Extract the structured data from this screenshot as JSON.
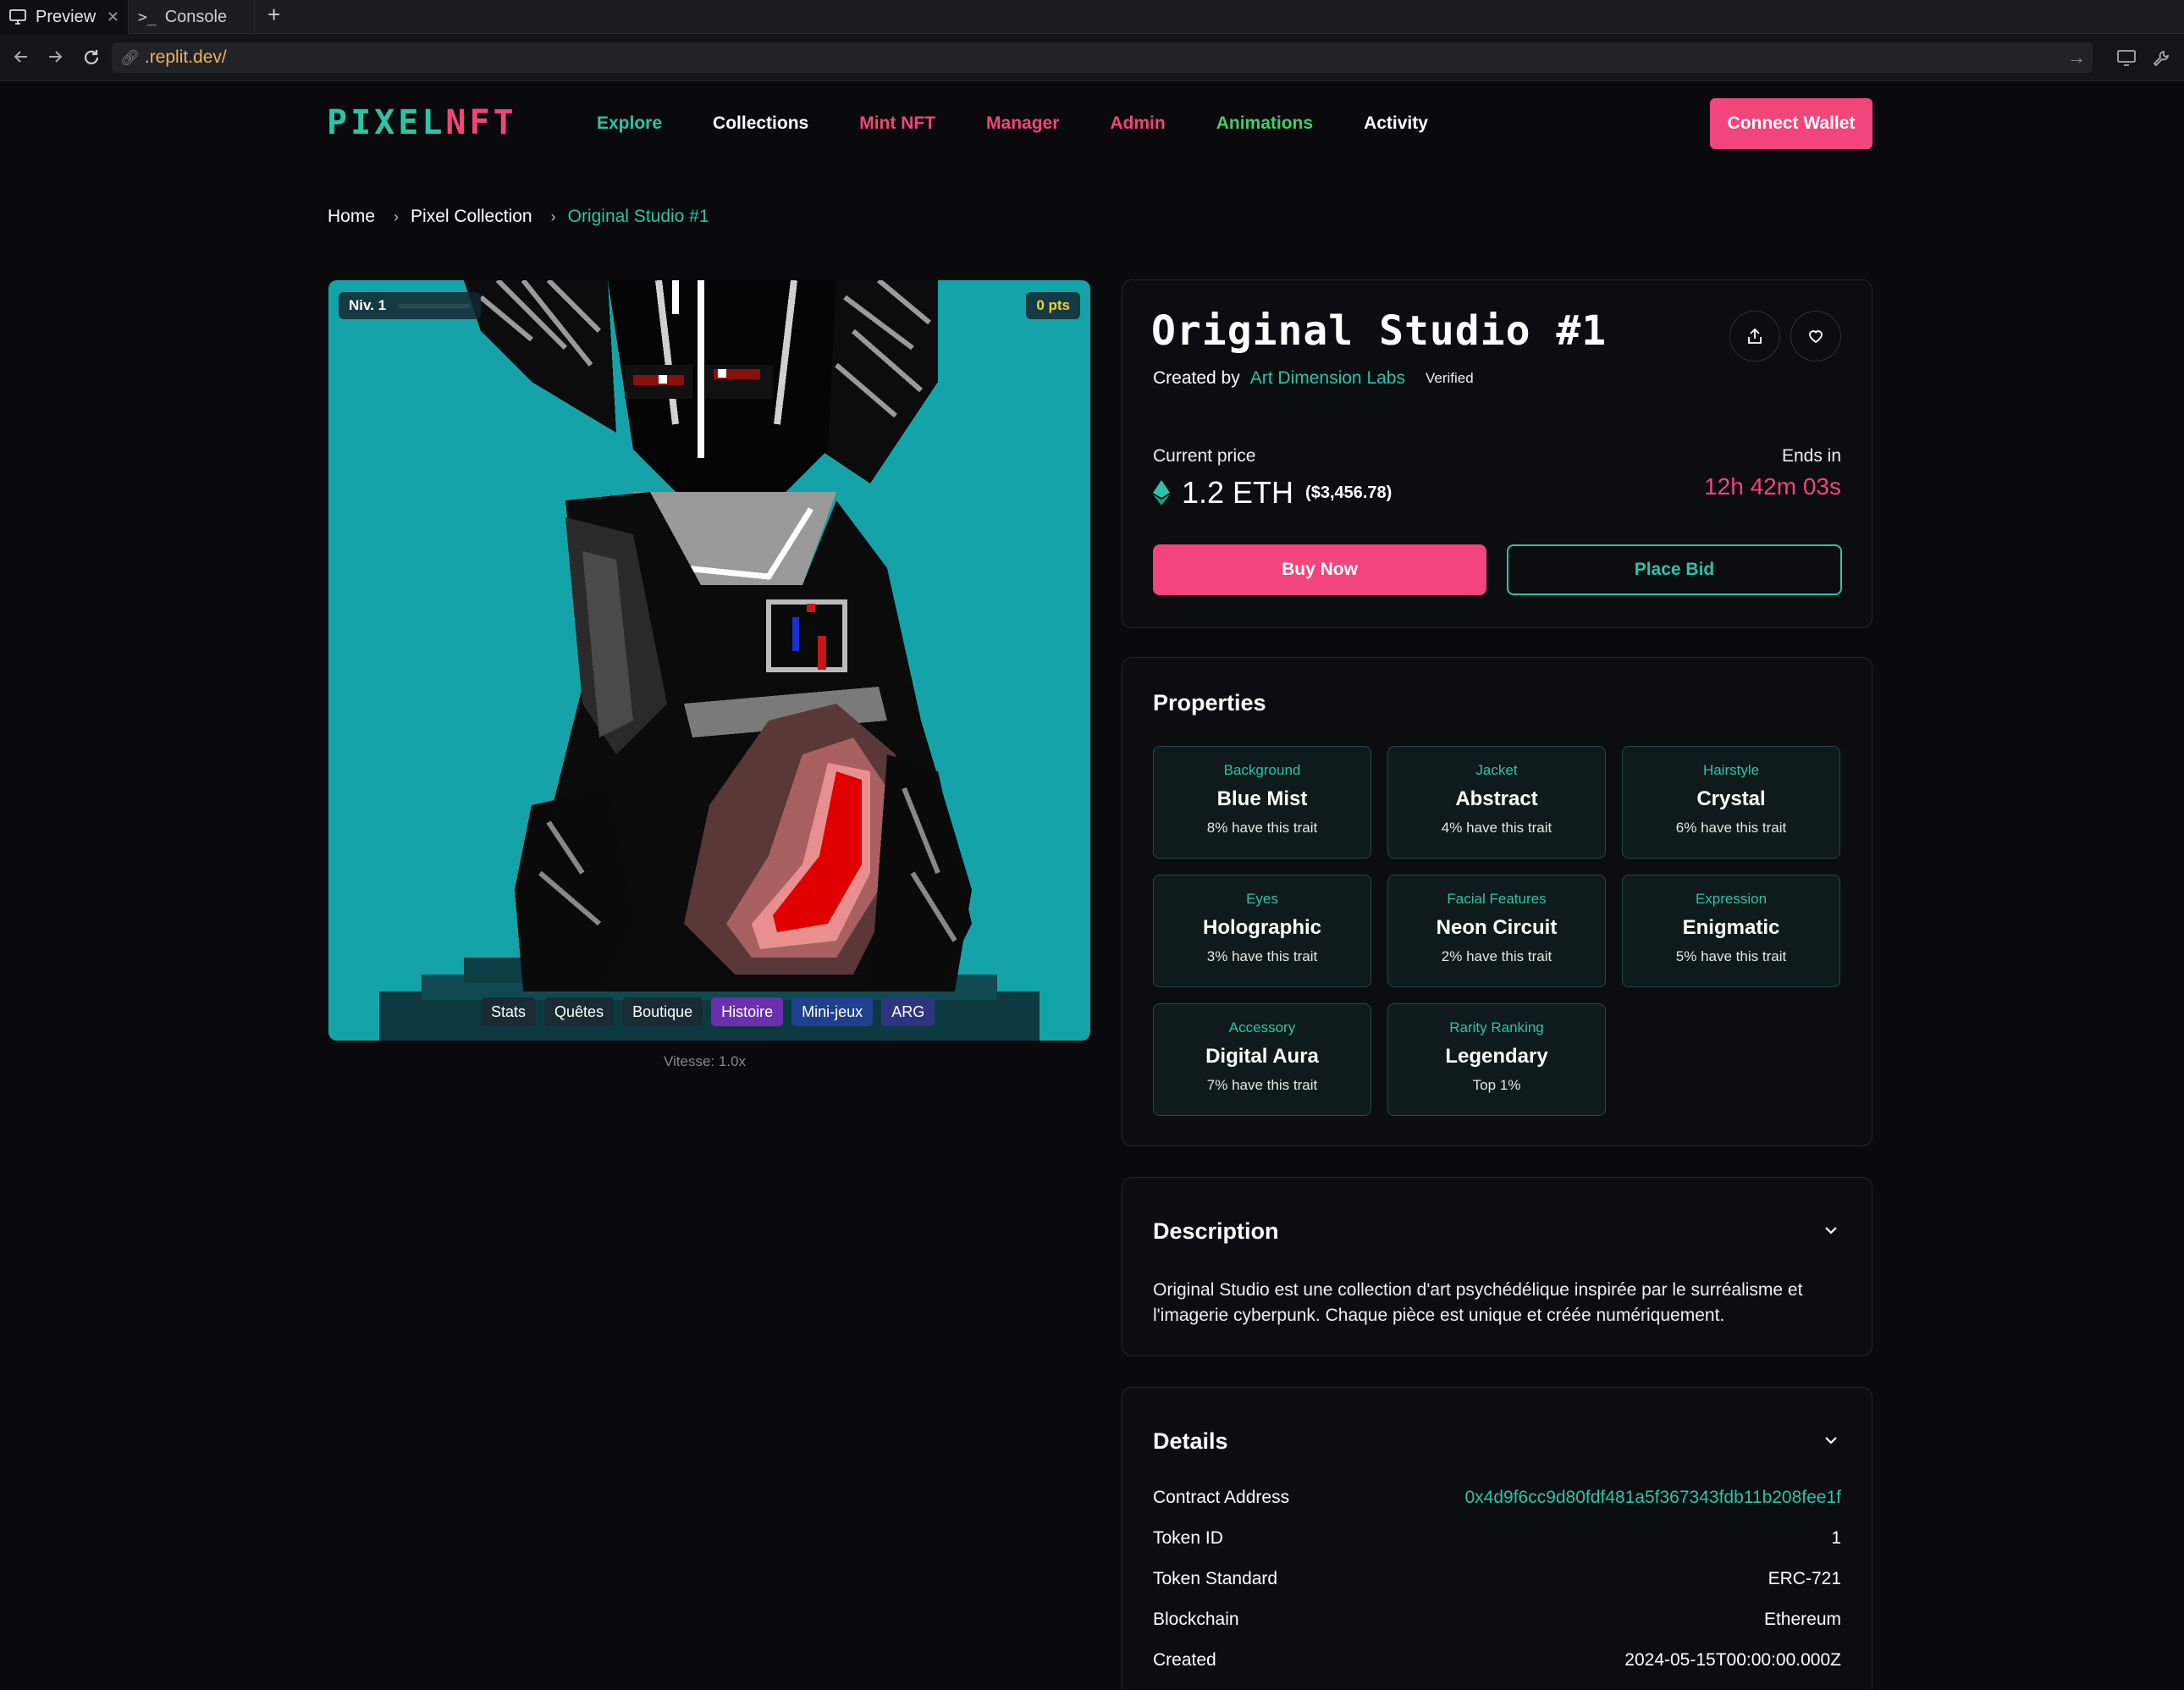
{
  "browser": {
    "tabs": [
      {
        "label": "Preview"
      },
      {
        "label": "Console"
      }
    ],
    "url": ".replit.dev/"
  },
  "header": {
    "logo_part1": "PIXEL",
    "logo_part2": "NFT",
    "menu": [
      {
        "label": "Explore",
        "color": "#2bc4a8"
      },
      {
        "label": "Collections",
        "color": "#ffffff"
      },
      {
        "label": "Mint NFT",
        "color": "#f2457b"
      },
      {
        "label": "Manager",
        "color": "#f2457b"
      },
      {
        "label": "Admin",
        "color": "#f2457b"
      },
      {
        "label": "Animations",
        "color": "#3fcf6a"
      },
      {
        "label": "Activity",
        "color": "#ffffff"
      }
    ],
    "connect_label": "Connect Wallet"
  },
  "breadcrumb": {
    "home": "Home",
    "collection": "Pixel Collection",
    "current": "Original Studio #1"
  },
  "artwork": {
    "level": "Niv. 1",
    "points": "0 pts",
    "tabs": [
      "Stats",
      "Quêtes",
      "Boutique",
      "Histoire",
      "Mini-jeux",
      "ARG"
    ],
    "speed": "Vitesse: 1.0x"
  },
  "nft": {
    "title": "Original Studio #1",
    "created_by_label": "Created by",
    "creator": "Art Dimension Labs",
    "verified": "Verified",
    "price_label": "Current price",
    "price_eth": "1.2 ETH",
    "price_usd": "($3,456.78)",
    "ends_label": "Ends in",
    "ends_value": "12h 42m 03s",
    "buy_label": "Buy Now",
    "bid_label": "Place Bid"
  },
  "properties": {
    "title": "Properties",
    "items": [
      {
        "key": "Background",
        "value": "Blue Mist",
        "rarity": "8% have this trait"
      },
      {
        "key": "Jacket",
        "value": "Abstract",
        "rarity": "4% have this trait"
      },
      {
        "key": "Hairstyle",
        "value": "Crystal",
        "rarity": "6% have this trait"
      },
      {
        "key": "Eyes",
        "value": "Holographic",
        "rarity": "3% have this trait"
      },
      {
        "key": "Facial Features",
        "value": "Neon Circuit",
        "rarity": "2% have this trait"
      },
      {
        "key": "Expression",
        "value": "Enigmatic",
        "rarity": "5% have this trait"
      },
      {
        "key": "Accessory",
        "value": "Digital Aura",
        "rarity": "7% have this trait"
      },
      {
        "key": "Rarity Ranking",
        "value": "Legendary",
        "rarity": "Top 1%"
      }
    ]
  },
  "description": {
    "title": "Description",
    "text": "Original Studio est une collection d'art psychédélique inspirée par le surréalisme et l'imagerie cyberpunk. Chaque pièce est unique et créée numériquement."
  },
  "details": {
    "title": "Details",
    "rows": [
      {
        "label": "Contract Address",
        "value": "0x4d9f6cc9d80fdf481a5f367343fdb11b208fee1f"
      },
      {
        "label": "Token ID",
        "value": "1"
      },
      {
        "label": "Token Standard",
        "value": "ERC-721"
      },
      {
        "label": "Blockchain",
        "value": "Ethereum"
      },
      {
        "label": "Created",
        "value": "2024-05-15T00:00:00.000Z"
      }
    ]
  },
  "colors": {
    "accent": "#2bc4a8",
    "brand": "#f2457b",
    "background": "#0a0a0c",
    "art_bg": "#14a3a8"
  }
}
